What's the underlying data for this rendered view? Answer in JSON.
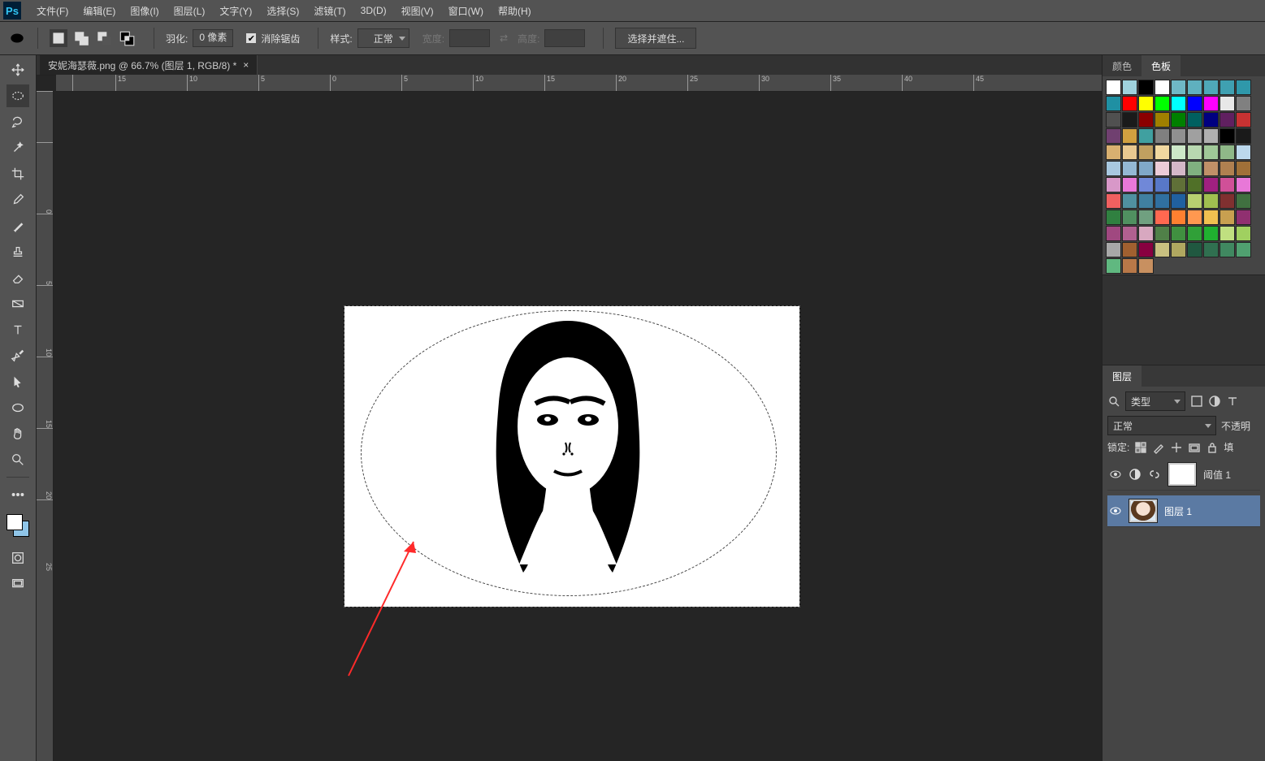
{
  "menubar": {
    "items": [
      "文件(F)",
      "编辑(E)",
      "图像(I)",
      "图层(L)",
      "文字(Y)",
      "选择(S)",
      "滤镜(T)",
      "3D(D)",
      "视图(V)",
      "窗口(W)",
      "帮助(H)"
    ]
  },
  "options": {
    "feather_label": "羽化:",
    "feather_value": "0 像素",
    "antialias_label": "消除锯齿",
    "style_label": "样式:",
    "style_value": "正常",
    "width_label": "宽度:",
    "height_label": "高度:",
    "select_mask_btn": "选择并遮住..."
  },
  "document": {
    "tab_title": "安妮海瑟薇.png @ 66.7% (图层 1, RGB/8) *"
  },
  "ruler_h": [
    "15",
    "10",
    "5",
    "0",
    "5",
    "10",
    "15",
    "20",
    "25",
    "30",
    "35",
    "40",
    "45"
  ],
  "ruler_v": [
    "0",
    "5",
    "10",
    "15",
    "20",
    "25"
  ],
  "panels": {
    "color_tab": "颜色",
    "swatch_tab": "色板",
    "layers_tab": "图层",
    "kind_label": "类型",
    "blend_value": "正常",
    "opacity_label": "不透明",
    "lock_label": "锁定:",
    "fill_label": "填",
    "layer_adj_name": "阈值 1",
    "layer1_name": "图层 1"
  },
  "swatch_colors": [
    "#ffffff",
    "#9fd2dc",
    "#000000",
    "#ffffff",
    "#6fb8c6",
    "#5fb0bf",
    "#4fa8b8",
    "#3fa0b1",
    "#2f98aa",
    "#1f90a3",
    "#ff0000",
    "#ffff00",
    "#00ff00",
    "#00ffff",
    "#0000ff",
    "#ff00ff",
    "#e8e8e8",
    "#808080",
    "#505050",
    "#1a1a1a",
    "#8b0000",
    "#a08000",
    "#008000",
    "#006060",
    "#000080",
    "#602060",
    "#c83232",
    "#704070",
    "#d0a040",
    "#40a0a0",
    "#808080",
    "#909090",
    "#a0a0a0",
    "#b0b0b0",
    "#000000",
    "#1a1a1a",
    "#d8b070",
    "#e8c890",
    "#c0a060",
    "#f0d8a0",
    "#cde8c8",
    "#b8d8b0",
    "#a0c898",
    "#8fb888",
    "#bcd8ec",
    "#a8c8e0",
    "#94b8d4",
    "#80a8c8",
    "#ecccd8",
    "#d4b8c8",
    "#80b080",
    "#c09068",
    "#b08050",
    "#a07038",
    "#d898c8",
    "#e878d8",
    "#7088d8",
    "#5878c8",
    "#607038",
    "#507028",
    "#a02080",
    "#d05098",
    "#e878d8",
    "#f06060",
    "#5090a0",
    "#4080a0",
    "#3070a0",
    "#2060a0",
    "#b8d070",
    "#a0c050",
    "#803030",
    "#407040",
    "#308040",
    "#509060",
    "#70a080",
    "#ff6850",
    "#ff8030",
    "#ff9850",
    "#f0c050",
    "#c8a050",
    "#903070",
    "#a04880",
    "#b06090",
    "#d8a8c0",
    "#508048",
    "#409040",
    "#30a038",
    "#20b030",
    "#c0e080",
    "#a0d060",
    "#a8a8a8",
    "#a06030",
    "#880040",
    "#c8c080",
    "#b0a860",
    "#205840",
    "#307050",
    "#408860",
    "#50a070",
    "#60b880",
    "#b87848",
    "#c89060"
  ]
}
